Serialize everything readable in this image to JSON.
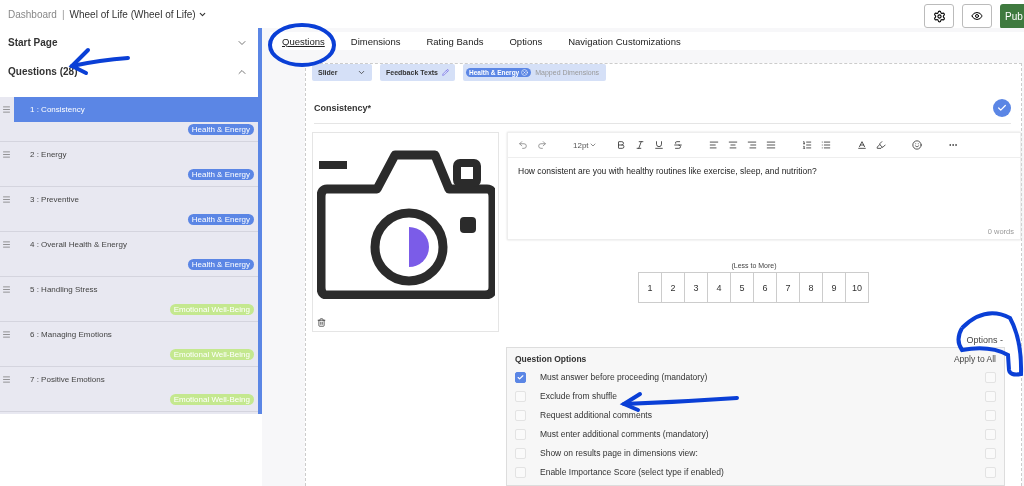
{
  "breadcrumb": {
    "home": "Dashboard",
    "separator": "|",
    "survey": "Wheel of Life (Wheel of Life)"
  },
  "header_buttons": {
    "publish": "Pub"
  },
  "sidebar": {
    "sections": [
      {
        "label": "Start Page",
        "expanded": false
      },
      {
        "label": "Questions (28)",
        "expanded": true
      }
    ],
    "items": [
      {
        "label": "1 : Consistency",
        "selected": true,
        "tag": "Health & Energy",
        "color": "#5b86e5"
      },
      {
        "label": "2 : Energy",
        "selected": false,
        "tag": "Health & Energy",
        "color": "#5b86e5"
      },
      {
        "label": "3 : Preventive",
        "selected": false,
        "tag": "Health & Energy",
        "color": "#5b86e5"
      },
      {
        "label": "4 : Overall Health & Energy",
        "selected": false,
        "tag": "Health & Energy",
        "color": "#5b86e5"
      },
      {
        "label": "5 : Handling Stress",
        "selected": false,
        "tag": "Emotional Well-Being",
        "color": "#c4e88f"
      },
      {
        "label": "6 : Managing Emotions",
        "selected": false,
        "tag": "Emotional Well-Being",
        "color": "#c4e88f"
      },
      {
        "label": "7 : Positive Emotions",
        "selected": false,
        "tag": "Emotional Well-Being",
        "color": "#c4e88f"
      }
    ]
  },
  "tabs": [
    {
      "label": "Questions",
      "selected": true
    },
    {
      "label": "Dimensions",
      "selected": false
    },
    {
      "label": "Rating Bands",
      "selected": false
    },
    {
      "label": "Options",
      "selected": false
    },
    {
      "label": "Navigation Customizations",
      "selected": false
    }
  ],
  "question": {
    "type": "Slider",
    "feedback": "Feedback Texts",
    "dimension_tag": "Health & Energy",
    "dimensions_placeholder": "Mapped Dimensions",
    "title": "Consistency*",
    "font_size": "12pt",
    "text": "How consistent are you with healthy routines like exercise, sleep, and nutrition?",
    "word_count": "0 words",
    "scale_label": "(Less to More)",
    "scale": [
      "1",
      "2",
      "3",
      "4",
      "5",
      "6",
      "7",
      "8",
      "9",
      "10"
    ],
    "options_toggle": "Options -"
  },
  "question_options": {
    "title": "Question Options",
    "apply_label": "Apply to All",
    "rows": [
      {
        "label": "Must answer before proceeding (mandatory)",
        "checked": true,
        "apply_all": false
      },
      {
        "label": "Exclude from shuffle",
        "checked": false,
        "apply_all": false
      },
      {
        "label": "Request additional comments",
        "checked": false,
        "apply_all": false
      },
      {
        "label": "Must enter additional comments (mandatory)",
        "checked": false,
        "apply_all": false
      },
      {
        "label": "Show on results page in dimensions view:",
        "checked": false,
        "apply_all": false
      },
      {
        "label": "Enable Importance Score (select type if enabled)",
        "checked": false,
        "apply_all": false
      }
    ]
  }
}
